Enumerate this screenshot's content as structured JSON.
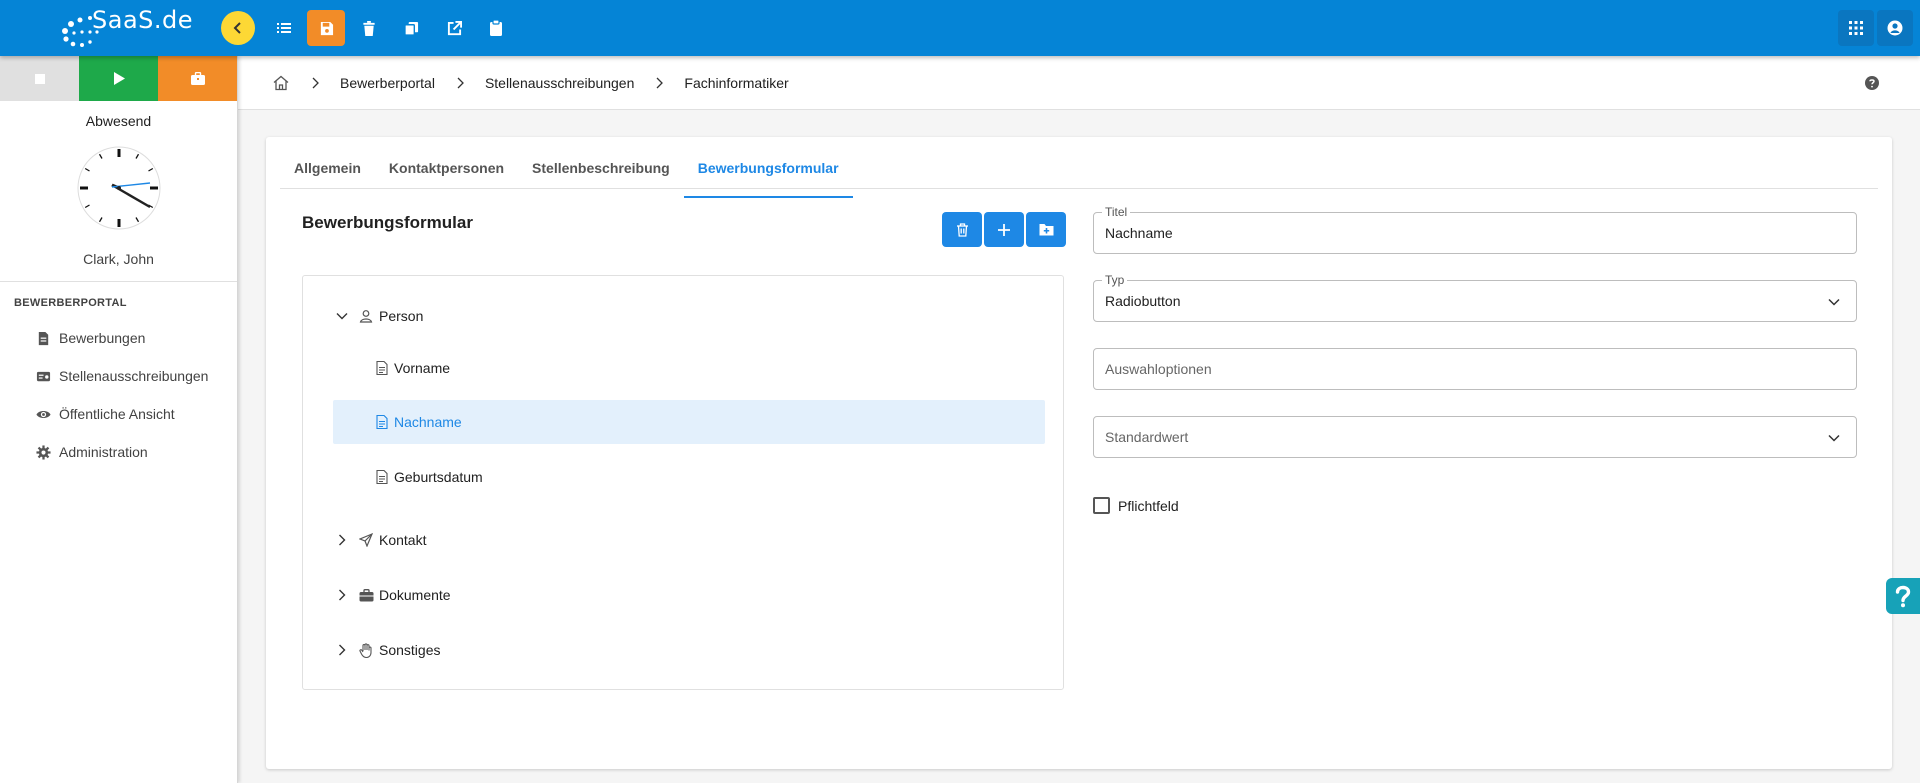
{
  "app": {
    "logo_text": "SaaS.de",
    "accent": "#0584d6",
    "active_tab_color": "#1e88e5"
  },
  "toolbar": {
    "icons": [
      "chevron-left-icon",
      "list-icon",
      "save-icon",
      "trash-icon",
      "copy-icon",
      "external-link-icon",
      "clipboard-icon"
    ],
    "active": "save-icon",
    "right_icons": [
      "apps-grid-icon",
      "user-circle-icon"
    ]
  },
  "sidebar": {
    "status_buttons": [
      "stop-icon",
      "play-icon",
      "briefcase-icon"
    ],
    "status_text": "Abwesend",
    "user_name": "Clark, John",
    "section_title": "BEWERBERPORTAL",
    "items": [
      {
        "label": "Bewerbungen",
        "icon": "document-icon"
      },
      {
        "label": "Stellenausschreibungen",
        "icon": "job-listing-icon"
      },
      {
        "label": "Öffentliche Ansicht",
        "icon": "eye-icon"
      },
      {
        "label": "Administration",
        "icon": "gear-icon"
      }
    ]
  },
  "breadcrumb": {
    "items": [
      "Bewerberportal",
      "Stellenausschreibungen",
      "Fachinformatiker"
    ]
  },
  "tabs": [
    {
      "label": "Allgemein",
      "active": false
    },
    {
      "label": "Kontaktpersonen",
      "active": false
    },
    {
      "label": "Stellenbeschreibung",
      "active": false
    },
    {
      "label": "Bewerbungsformular",
      "active": true
    }
  ],
  "form": {
    "title": "Bewerbungsformular",
    "tree": [
      {
        "label": "Person",
        "icon": "person-icon",
        "expanded": true,
        "children": [
          {
            "label": "Vorname",
            "icon": "file-icon"
          },
          {
            "label": "Nachname",
            "icon": "file-icon",
            "selected": true
          },
          {
            "label": "Geburtsdatum",
            "icon": "file-icon"
          }
        ]
      },
      {
        "label": "Kontakt",
        "icon": "send-icon",
        "expanded": false
      },
      {
        "label": "Dokumente",
        "icon": "briefcase-icon",
        "expanded": false
      },
      {
        "label": "Sonstiges",
        "icon": "hand-icon",
        "expanded": false
      }
    ]
  },
  "details": {
    "title_label": "Titel",
    "title_value": "Nachname",
    "type_label": "Typ",
    "type_value": "Radiobutton",
    "options_placeholder": "Auswahloptionen",
    "default_placeholder": "Standardwert",
    "required_label": "Pflichtfeld",
    "required_checked": false
  }
}
